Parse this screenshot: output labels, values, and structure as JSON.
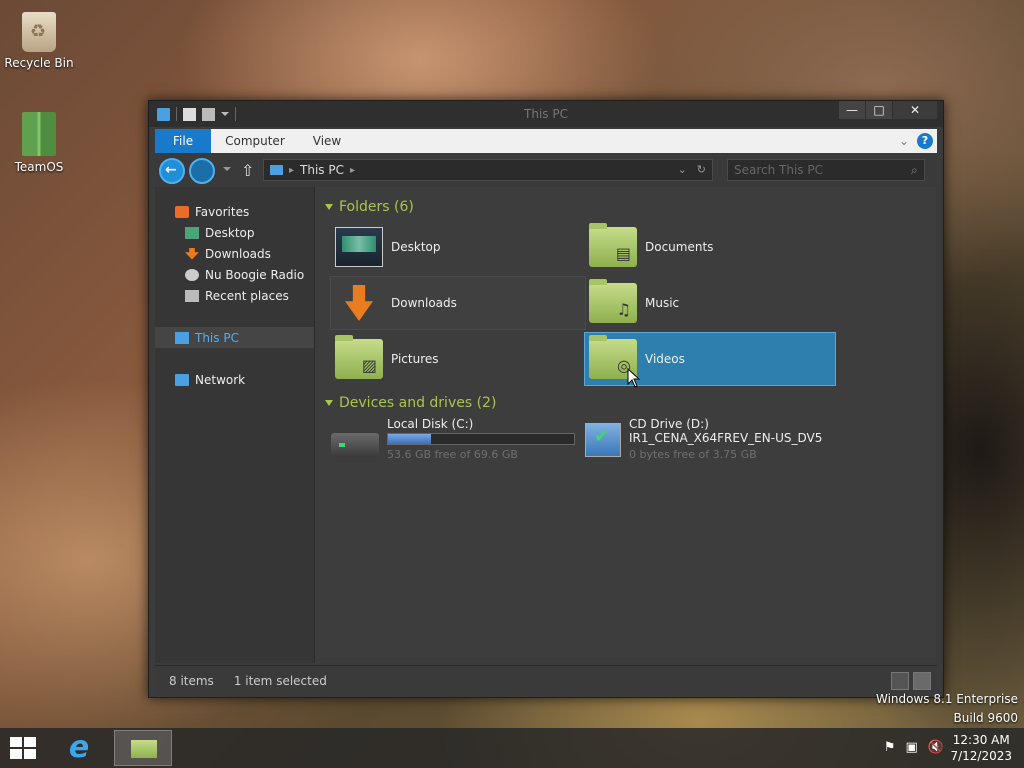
{
  "desktop": {
    "icons": [
      {
        "label": "Recycle Bin",
        "icon": "recycle-bin-icon"
      },
      {
        "label": "TeamOS",
        "icon": "folder-icon"
      }
    ],
    "watermark": {
      "line1": "Windows 8.1 Enterprise",
      "line2": "Build 9600"
    }
  },
  "window": {
    "title": "This PC",
    "controls": {
      "minimize": "—",
      "maximize": "□",
      "close": "✕"
    },
    "ribbon": {
      "tabs": [
        "File",
        "Computer",
        "View"
      ]
    },
    "address": {
      "crumb": "This PC",
      "search_placeholder": "Search This PC"
    },
    "nav": {
      "favorites": "Favorites",
      "favorites_items": [
        "Desktop",
        "Downloads",
        "Nu Boogie Radio",
        "Recent places"
      ],
      "this_pc": "This PC",
      "network": "Network"
    },
    "folders_header": "Folders (6)",
    "folders": [
      {
        "name": "Desktop",
        "icon": "desktop-thumb-icon"
      },
      {
        "name": "Documents",
        "icon": "documents-folder-icon"
      },
      {
        "name": "Downloads",
        "icon": "downloads-arrow-icon"
      },
      {
        "name": "Music",
        "icon": "music-folder-icon"
      },
      {
        "name": "Pictures",
        "icon": "pictures-folder-icon"
      },
      {
        "name": "Videos",
        "icon": "videos-folder-icon"
      }
    ],
    "drives_header": "Devices and drives (2)",
    "drives": [
      {
        "name": "Local Disk (C:)",
        "free": "53.6 GB free of 69.6 GB",
        "used_fraction": 0.23
      },
      {
        "name": "CD Drive (D:)",
        "label": "IR1_CENA_X64FREV_EN-US_DV5",
        "free": "0 bytes free of 3.75 GB"
      }
    ],
    "status": {
      "items": "8 items",
      "selected": "1 item selected"
    }
  },
  "taskbar": {
    "clock_time": "12:30 AM",
    "clock_date": "7/12/2023"
  },
  "colors": {
    "accent": "#1979ca",
    "group": "#a9c64a",
    "selection": "#2e7fae"
  }
}
